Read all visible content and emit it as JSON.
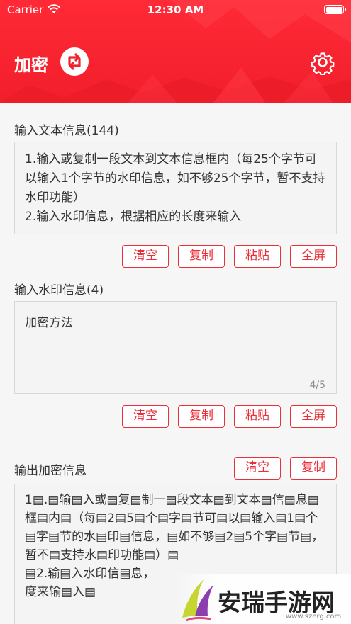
{
  "status": {
    "carrier": "Carrier",
    "time": "12:30 AM"
  },
  "header": {
    "title": "加密",
    "swap_icon": "swap-icon",
    "settings_icon": "gear-icon"
  },
  "input_text": {
    "label": "输入文本信息(144)",
    "value": "1.输入或复制一段文本到文本信息框内（每25个字节可以输入1个字节的水印信息，如不够25个字节，暂不支持水印功能）\n2.输入水印信息，根据相应的长度来输入",
    "buttons": [
      "清空",
      "复制",
      "粘贴",
      "全屏"
    ]
  },
  "watermark_input": {
    "label": "输入水印信息(4)",
    "value": "加密方法",
    "counter": "4/5",
    "buttons": [
      "清空",
      "复制",
      "粘贴",
      "全屏"
    ]
  },
  "output": {
    "label": "输出加密信息",
    "buttons": [
      "清空",
      "复制"
    ],
    "value": "1▤.▤输▤入或▤复▤制一▤段文本▤到文本▤信▤息▤框▤内▤（每▤2▤5▤个▤字▤节可▤以▤输入▤1▤个▤字▤节的水▤印▤信息，▤如不够▤2▤5个字▤节▤，暂不▤支持水▤印功能▤）▤\n▤2.输▤入水印信▤息，\n度来输▤入▤"
  },
  "site_watermark": {
    "name": "安瑞手游网",
    "url": "www.szerg.com"
  }
}
